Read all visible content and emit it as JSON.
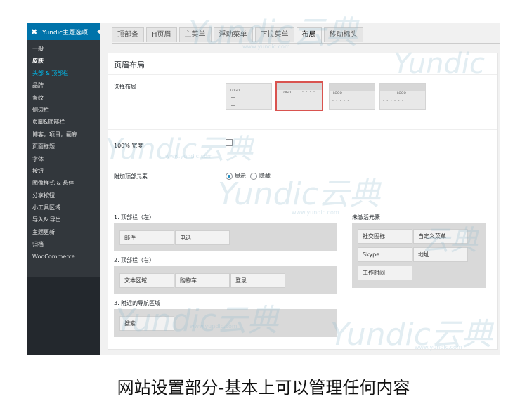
{
  "sidebar": {
    "header_title": "Yundic主题选项",
    "items": [
      {
        "label": "一般",
        "state": "normal"
      },
      {
        "label": "皮肤",
        "state": "current"
      },
      {
        "label": "头部 & 顶部栏",
        "state": "highlight"
      },
      {
        "label": "品牌",
        "state": "normal"
      },
      {
        "label": "条纹",
        "state": "normal"
      },
      {
        "label": "侧边栏",
        "state": "normal"
      },
      {
        "label": "页脚&底部栏",
        "state": "normal"
      },
      {
        "label": "博客，项目，画廊",
        "state": "normal"
      },
      {
        "label": "页面标题",
        "state": "normal"
      },
      {
        "label": "字体",
        "state": "normal"
      },
      {
        "label": "按钮",
        "state": "normal"
      },
      {
        "label": "图像样式 & 悬停",
        "state": "normal"
      },
      {
        "label": "分享按钮",
        "state": "normal"
      },
      {
        "label": "小工具区域",
        "state": "normal"
      },
      {
        "label": "导入& 导出",
        "state": "normal"
      },
      {
        "label": "主题更新",
        "state": "normal"
      },
      {
        "label": "归档",
        "state": "normal"
      },
      {
        "label": "WooCommerce",
        "state": "normal"
      }
    ]
  },
  "tabs": [
    {
      "label": "顶部条",
      "active": false
    },
    {
      "label": "H页眉",
      "active": false
    },
    {
      "label": "主菜单",
      "active": false
    },
    {
      "label": "浮动菜单",
      "active": false
    },
    {
      "label": "下拉菜单",
      "active": false
    },
    {
      "label": "布局",
      "active": true
    },
    {
      "label": "移动标头",
      "active": false
    }
  ],
  "panel": {
    "title": "页眉布局",
    "select_layout_label": "选择布局",
    "layout_logo_text": "LOGO",
    "selected_layout_index": 1,
    "full_width_label": "100% 宽度",
    "full_width_checked": false,
    "extra_top_label": "附加顶部元素",
    "radio_show": "显示",
    "radio_hide": "隐藏",
    "radio_selected": "显示"
  },
  "zones": {
    "top_left_label": "1. 顶部栏（左）",
    "top_left_items": [
      "邮件",
      "电话"
    ],
    "top_right_label": "2. 顶部栏（右）",
    "top_right_items": [
      "文本区域",
      "购物车",
      "登录"
    ],
    "nav_label": "3. 附近的导航区域",
    "nav_items": [
      "搜索"
    ],
    "inactive_label": "未激活元素",
    "inactive_items": [
      "社交图标",
      "自定义菜单",
      "Skype",
      "地址",
      "工作时间"
    ]
  },
  "watermark": {
    "brand": "Yundic",
    "cn": "云典",
    "url": "www.yundic.com"
  },
  "caption": "网站设置部分-基本上可以管理任何内容",
  "colors": {
    "sidebar_bg": "#23282d",
    "sidebar_sub_bg": "#32373c",
    "accent_blue": "#0073aa",
    "highlight_text": "#00b9eb",
    "selected_layout_border": "#d9534f",
    "zone_bg": "#d9d9d9"
  }
}
